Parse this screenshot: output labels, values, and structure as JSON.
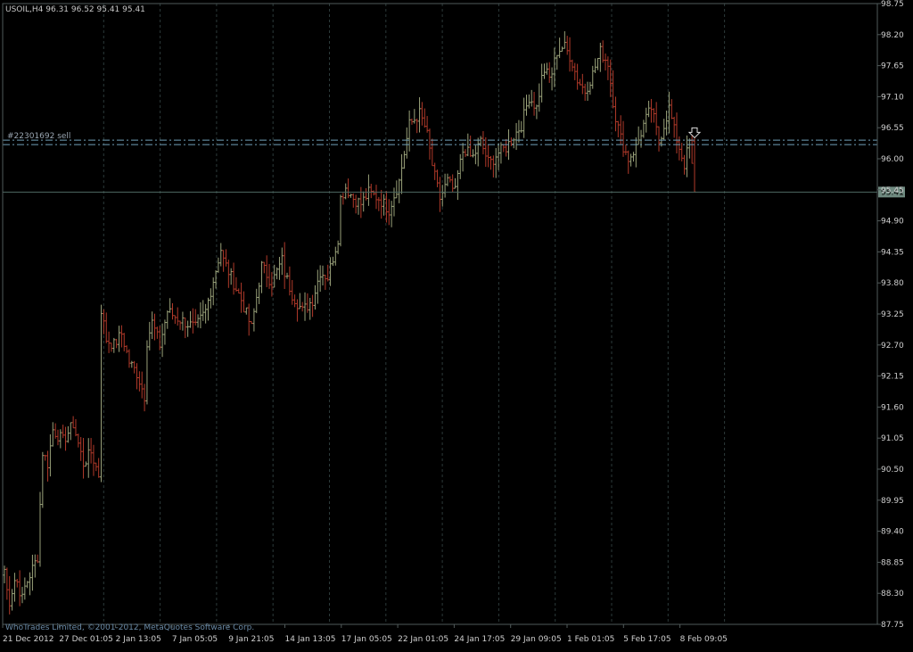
{
  "header": {
    "symbol_line": "USOIL,H4  96.31 96.52 95.41 95.41"
  },
  "footer": {
    "copyright": "WhoTrades Limited, ©2001-2012, MetaQuotes Software Corp."
  },
  "order_label": "#22301692 sell",
  "current_price_label": "95.41",
  "colors": {
    "background": "#000000",
    "up_bar": "#9aa27a",
    "down_bar": "#b23a2a",
    "grid": "#2c3a3a",
    "axis": "#505a5a",
    "order_line": "#6fa0b8",
    "price_line": "#4e6a62"
  },
  "chart_data": {
    "type": "ohlc",
    "title": "USOIL,H4",
    "last_bar": {
      "open": 96.31,
      "high": 96.52,
      "low": 95.41,
      "close": 95.41
    },
    "ylim": [
      87.75,
      98.75
    ],
    "y_ticks": [
      "98.75",
      "98.20",
      "97.65",
      "97.10",
      "96.55",
      "96.00",
      "95.45",
      "94.90",
      "94.35",
      "93.80",
      "93.25",
      "92.70",
      "92.15",
      "91.60",
      "91.05",
      "90.50",
      "89.95",
      "89.40",
      "88.85",
      "88.30",
      "87.75"
    ],
    "x_ticks": [
      "21 Dec 2012",
      "27 Dec 01:05",
      "2 Jan 13:05",
      "7 Jan 05:05",
      "9 Jan 21:05",
      "14 Jan 13:05",
      "17 Jan 05:05",
      "22 Jan 01:05",
      "24 Jan 17:05",
      "29 Jan 09:05",
      "1 Feb 01:05",
      "5 Feb 17:05",
      "8 Feb 09:05"
    ],
    "order_lines": [
      {
        "name": "#22301692 sell",
        "price": 96.33
      },
      {
        "price": 96.25
      }
    ],
    "current_price": 95.41,
    "segments": [
      {
        "n": 8,
        "path": [
          89.1,
          88.1,
          88.6,
          88.2
        ]
      },
      {
        "n": 6,
        "path": [
          88.3,
          88.95
        ]
      },
      {
        "n": 6,
        "path": [
          88.95,
          90.8,
          90.6,
          91.2
        ]
      },
      {
        "n": 12,
        "path": [
          91.2,
          91.0,
          91.3,
          90.6
        ]
      },
      {
        "n": 6,
        "path": [
          90.6,
          90.8,
          90.4
        ]
      },
      {
        "n": 6,
        "path": [
          93.6,
          92.8,
          92.7
        ]
      },
      {
        "n": 12,
        "path": [
          92.7,
          92.9,
          92.4,
          92.2,
          91.8
        ]
      },
      {
        "n": 12,
        "path": [
          92.6,
          93.1,
          92.7,
          93.3,
          93.2
        ]
      },
      {
        "n": 12,
        "path": [
          93.2,
          93.1,
          93.0,
          93.3
        ]
      },
      {
        "n": 6,
        "path": [
          93.3,
          94.4
        ]
      },
      {
        "n": 12,
        "path": [
          94.3,
          93.9,
          93.5,
          93.0
        ]
      },
      {
        "n": 12,
        "path": [
          93.0,
          94.1,
          93.8,
          94.2
        ]
      },
      {
        "n": 12,
        "path": [
          94.1,
          93.6,
          93.3,
          93.5
        ]
      },
      {
        "n": 6,
        "path": [
          93.5,
          94.0,
          93.9
        ]
      },
      {
        "n": 4,
        "path": [
          93.9,
          94.6
        ]
      },
      {
        "n": 12,
        "path": [
          95.2,
          95.5,
          95.3,
          95.2,
          95.4
        ]
      },
      {
        "n": 12,
        "path": [
          95.4,
          95.3,
          95.1,
          95.6
        ]
      },
      {
        "n": 8,
        "path": [
          95.6,
          96.6,
          96.8
        ]
      },
      {
        "n": 8,
        "path": [
          96.8,
          96.5,
          95.8,
          95.3
        ]
      },
      {
        "n": 6,
        "path": [
          95.3,
          95.6,
          95.4
        ]
      },
      {
        "n": 10,
        "path": [
          95.5,
          96.2,
          96.0,
          96.3
        ]
      },
      {
        "n": 10,
        "path": [
          96.3,
          95.9,
          96.1,
          96.2
        ]
      },
      {
        "n": 6,
        "path": [
          96.2,
          96.6
        ]
      },
      {
        "n": 6,
        "path": [
          96.6,
          97.1,
          96.9
        ]
      },
      {
        "n": 8,
        "path": [
          96.9,
          97.6,
          97.4,
          97.9
        ]
      },
      {
        "n": 8,
        "path": [
          97.9,
          98.0,
          97.8,
          97.4
        ]
      },
      {
        "n": 6,
        "path": [
          97.4,
          97.2,
          97.5
        ]
      },
      {
        "n": 6,
        "path": [
          97.5,
          97.9,
          97.7
        ]
      },
      {
        "n": 8,
        "path": [
          97.7,
          96.8,
          96.3,
          96.0
        ]
      },
      {
        "n": 6,
        "path": [
          96.0,
          96.2,
          96.6
        ]
      },
      {
        "n": 6,
        "path": [
          96.6,
          96.9,
          96.3
        ]
      },
      {
        "n": 6,
        "path": [
          96.3,
          96.6,
          96.9,
          96.5
        ]
      },
      {
        "n": 4,
        "path": [
          96.5,
          96.2,
          95.9
        ]
      },
      {
        "n": 4,
        "path": [
          95.9,
          96.3,
          95.41
        ]
      }
    ]
  }
}
